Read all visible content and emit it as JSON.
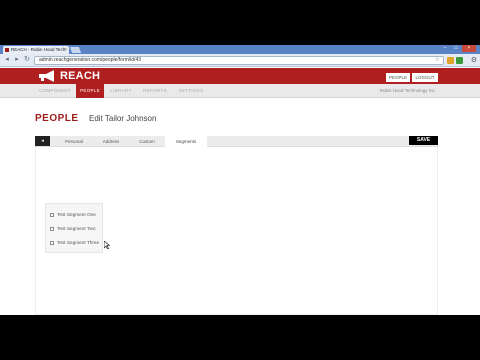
{
  "browser": {
    "tab_title": "REACH - Rubin Hood Tech",
    "tab_close_glyph": "×",
    "window_min_glyph": "–",
    "window_max_glyph": "▭",
    "window_close_glyph": "×",
    "back_glyph": "◂",
    "forward_glyph": "▸",
    "reload_glyph": "↻",
    "url": "admin.reachgeneration.com/people/form/id/43",
    "star_glyph": "☆",
    "wrench_glyph": "⚙"
  },
  "header": {
    "logo_text": "REACH",
    "people_button": "PEOPLE",
    "logout_button": "LOGOUT"
  },
  "subnav": {
    "items": [
      "COMPONENT",
      "PEOPLE",
      "LIBRARY",
      "REPORTS",
      "SETTINGS"
    ],
    "active_index": 1,
    "company": "Rubin Hood Technology Inc."
  },
  "page": {
    "title": "PEOPLE",
    "subtitle": "Edit Tailor Johnson",
    "back_glyph": "◂",
    "tabs": [
      "Personal",
      "Address",
      "Custom",
      "Segments"
    ],
    "active_tab": "Segments",
    "save_label": "SAVE"
  },
  "segments": [
    {
      "label": "Test Segment One",
      "checked": false
    },
    {
      "label": "Test Segment Two",
      "checked": false
    },
    {
      "label": "Test Segment Three",
      "checked": false
    }
  ],
  "colors": {
    "brand_red": "#b01f1f",
    "title_red": "#9e1b1b",
    "chrome_blue": "#5a82c6"
  }
}
